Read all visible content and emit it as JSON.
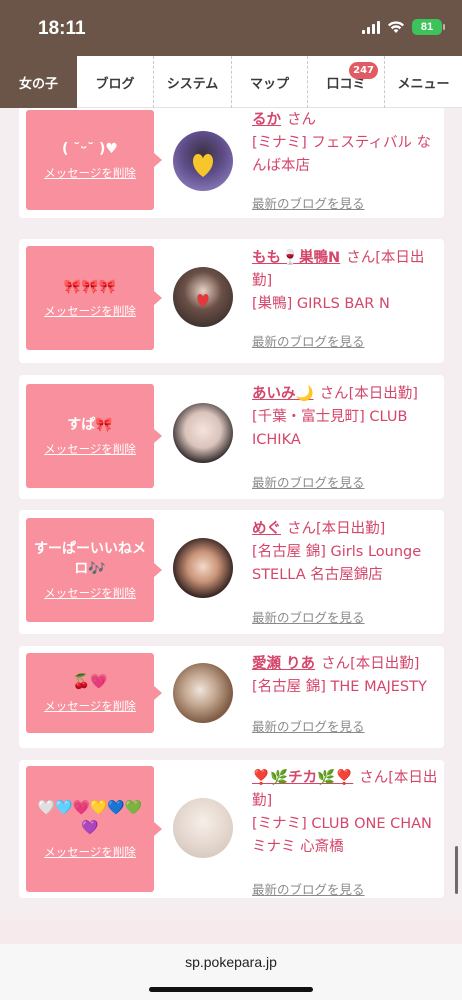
{
  "status": {
    "time": "18:11",
    "battery": "81"
  },
  "nav": {
    "tabs": [
      {
        "label": "女の子"
      },
      {
        "label": "ブログ"
      },
      {
        "label": "システム"
      },
      {
        "label": "マップ"
      },
      {
        "label": "口コミ",
        "badge": "247"
      },
      {
        "label": "メニュー"
      }
    ]
  },
  "list": {
    "delete_label": "メッセージを削除",
    "san_label": "さん",
    "blog_link_label": "最新のブログを見る",
    "items": [
      {
        "message": "( ˘ᵕ˘ )♥",
        "name": "るか",
        "suffix": "",
        "shop": "[ミナミ] フェスティバル なんば本店"
      },
      {
        "message": "🎀🎀🎀",
        "name": "もも🍷巣鴨N",
        "suffix": "[本日出勤]",
        "shop": "[巣鴨] GIRLS BAR N"
      },
      {
        "message": "すぱ🎀",
        "name": "あいみ🌙",
        "suffix": "[本日出勤]",
        "shop": "[千葉・富士見町] CLUB ICHIKA"
      },
      {
        "message": "すーぱーいいねメロ🎶",
        "name": "めぐ",
        "suffix": "[本日出勤]",
        "shop": "[名古屋 錦] Girls Lounge STELLA 名古屋錦店"
      },
      {
        "message": "🍒💗",
        "name": "愛瀬 りあ",
        "suffix": "[本日出勤]",
        "shop": "[名古屋 錦] THE MAJESTY"
      },
      {
        "message": "🤍🩵💗💛💙💚💜",
        "name": "❣️🌿チカ🌿❣️",
        "suffix": "[本日出勤]",
        "shop": "[ミナミ] CLUB ONE CHAN ミナミ 心斎橋"
      }
    ]
  },
  "browser": {
    "url": "sp.pokepara.jp"
  }
}
